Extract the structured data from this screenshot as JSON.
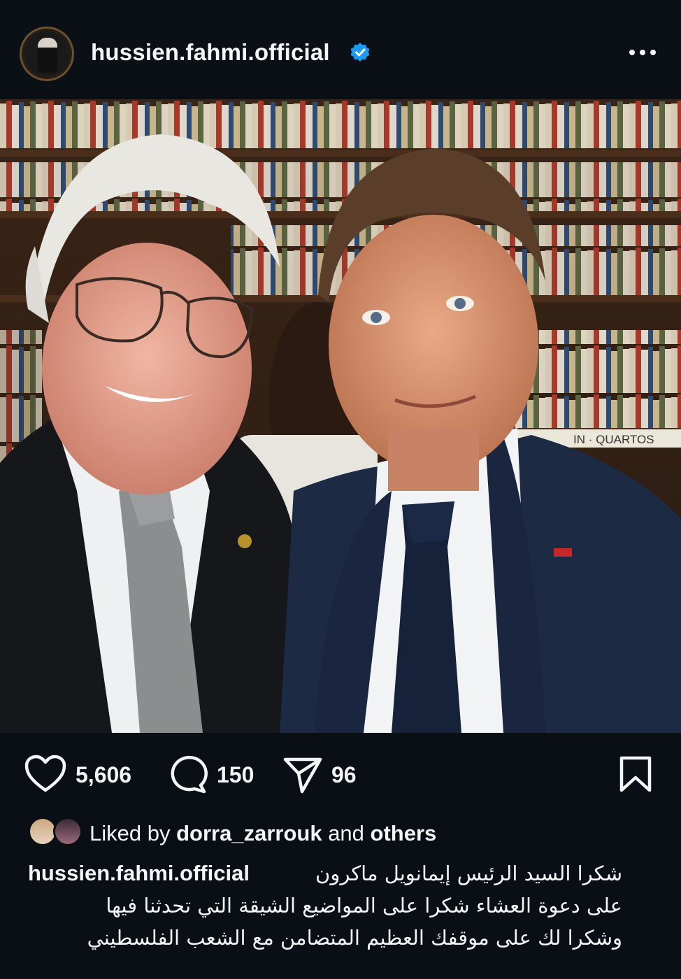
{
  "header": {
    "username": "hussien.fahmi.official",
    "avatar_icon": "profile-avatar",
    "verified_icon": "verified-badge-icon",
    "more_icon": "more-options-icon"
  },
  "photo": {
    "shelf_label": "IN · QUARTOS"
  },
  "actions": {
    "likes": "5,606",
    "comments": "150",
    "shares": "96"
  },
  "liked_by": {
    "prefix": "Liked by",
    "user": "dorra_zarrouk",
    "middle": "and",
    "suffix": "others"
  },
  "caption": {
    "username": "hussien.fahmi.official",
    "lines": [
      "شكرا السيد الرئيس إيمانويل ماكرون",
      "على دعوة العشاء شكرا على المواضيع الشيقة التي تحدثنا فيها",
      "وشكرا لك على موقفك العظيم المتضامن مع الشعب الفلسطيني"
    ]
  },
  "colors": {
    "background": "#0a0e15",
    "verified": "#1d9bf0",
    "text": "#f3f5f7"
  }
}
